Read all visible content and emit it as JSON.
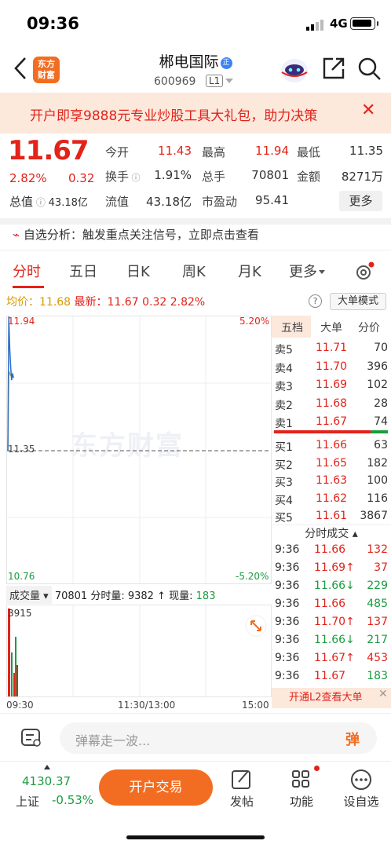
{
  "status": {
    "time": "09:36",
    "network": "4G"
  },
  "header": {
    "back_icon": "chevron-left-icon",
    "logo_line1": "东方",
    "logo_line2": "财富",
    "stock_name": "郴电国际",
    "badge": "正",
    "code": "600969",
    "level": "L1"
  },
  "banner": {
    "text": "开户即享9888元专业炒股工具大礼包，助力决策",
    "close": "✕"
  },
  "quote": {
    "price": "11.67",
    "change_pct": "2.82%",
    "change": "0.32",
    "market_value_label": "总值",
    "market_value": "43.18亿",
    "stats": [
      {
        "label": "今开",
        "value": "11.43",
        "color": "#e2231a"
      },
      {
        "label": "最高",
        "value": "11.94",
        "color": "#e2231a"
      },
      {
        "label": "最低",
        "value": "11.35",
        "color": "#333333"
      },
      {
        "label": "换手",
        "value": "1.91%",
        "color": "#333333"
      },
      {
        "label": "总手",
        "value": "70801",
        "color": "#333333"
      },
      {
        "label": "金额",
        "value": "8271万",
        "color": "#333333"
      },
      {
        "label": "流值",
        "value": "43.18亿",
        "color": "#333333"
      },
      {
        "label": "市盈动",
        "value": "95.41",
        "color": "#333333"
      }
    ],
    "more": "更多"
  },
  "analysis": {
    "label": "自选分析：",
    "text": "触发重点关注信号，立即点击查看"
  },
  "tabs": [
    "分时",
    "五日",
    "日K",
    "周K",
    "月K",
    "更多"
  ],
  "infoline": {
    "avg_label": "均价：",
    "avg": "11.68",
    "last_label": "最新：",
    "last": "11.67",
    "chg": "0.32",
    "pct": "2.82%",
    "big_order": "大单模式"
  },
  "chart_data": {
    "type": "line",
    "y_max": "11.94",
    "y_mid": "11.35",
    "y_min": "10.76",
    "pct_max": "5.20%",
    "pct_min": "-5.20%",
    "x_labels": [
      "09:30",
      "11:30/13:00",
      "15:00"
    ],
    "price_series": [
      11.35,
      11.94,
      11.8,
      11.72,
      11.66,
      11.69,
      11.67
    ],
    "avg_series": [
      11.35,
      11.7,
      11.69,
      11.68,
      11.68
    ],
    "volume": {
      "label": "成交量",
      "max": "3915",
      "total": "70801",
      "tick_label": "分时量:",
      "tick": "9382",
      "now_label": "现量:",
      "now": "183"
    }
  },
  "orderbook": {
    "tabs": [
      "五档",
      "大单",
      "分价"
    ],
    "asks": [
      {
        "label": "卖5",
        "price": "11.71",
        "vol": "70"
      },
      {
        "label": "卖4",
        "price": "11.70",
        "vol": "396"
      },
      {
        "label": "卖3",
        "price": "11.69",
        "vol": "102"
      },
      {
        "label": "卖2",
        "price": "11.68",
        "vol": "28"
      },
      {
        "label": "卖1",
        "price": "11.67",
        "vol": "74"
      }
    ],
    "bids": [
      {
        "label": "买1",
        "price": "11.66",
        "vol": "63"
      },
      {
        "label": "买2",
        "price": "11.65",
        "vol": "182"
      },
      {
        "label": "买3",
        "price": "11.63",
        "vol": "100"
      },
      {
        "label": "买4",
        "price": "11.62",
        "vol": "116"
      },
      {
        "label": "买5",
        "price": "11.61",
        "vol": "3867"
      }
    ],
    "trades_title": "分时成交",
    "trades": [
      {
        "time": "9:36",
        "price": "11.66",
        "dir": "",
        "vol": "132",
        "vcolor": "#e2231a"
      },
      {
        "time": "9:36",
        "price": "11.69↑",
        "dir": "",
        "vol": "37",
        "vcolor": "#e2231a"
      },
      {
        "time": "9:36",
        "price": "11.66↓",
        "dir": "",
        "vol": "229",
        "vcolor": "#1a9c3e"
      },
      {
        "time": "9:36",
        "price": "11.66",
        "dir": "",
        "vol": "485",
        "vcolor": "#1a9c3e"
      },
      {
        "time": "9:36",
        "price": "11.70↑",
        "dir": "",
        "vol": "137",
        "vcolor": "#e2231a"
      },
      {
        "time": "9:36",
        "price": "11.66↓",
        "dir": "",
        "vol": "217",
        "vcolor": "#1a9c3e"
      },
      {
        "time": "9:36",
        "price": "11.67↑",
        "dir": "",
        "vol": "453",
        "vcolor": "#e2231a"
      },
      {
        "time": "9:36",
        "price": "11.67",
        "dir": "",
        "vol": "183",
        "vcolor": "#1a9c3e"
      }
    ],
    "l2": "开通L2查看大单"
  },
  "watermark": "东方财富",
  "danmu": {
    "placeholder": "弹幕走一波...",
    "button": "弹"
  },
  "bottom": {
    "index_value": "4130.37",
    "index_name": "上证",
    "index_change": "-0.53%",
    "trade": "开户交易",
    "nav": [
      {
        "label": "发帖",
        "icon": "edit-icon"
      },
      {
        "label": "功能",
        "icon": "grid-icon"
      },
      {
        "label": "设自选",
        "icon": "more-icon"
      }
    ]
  }
}
